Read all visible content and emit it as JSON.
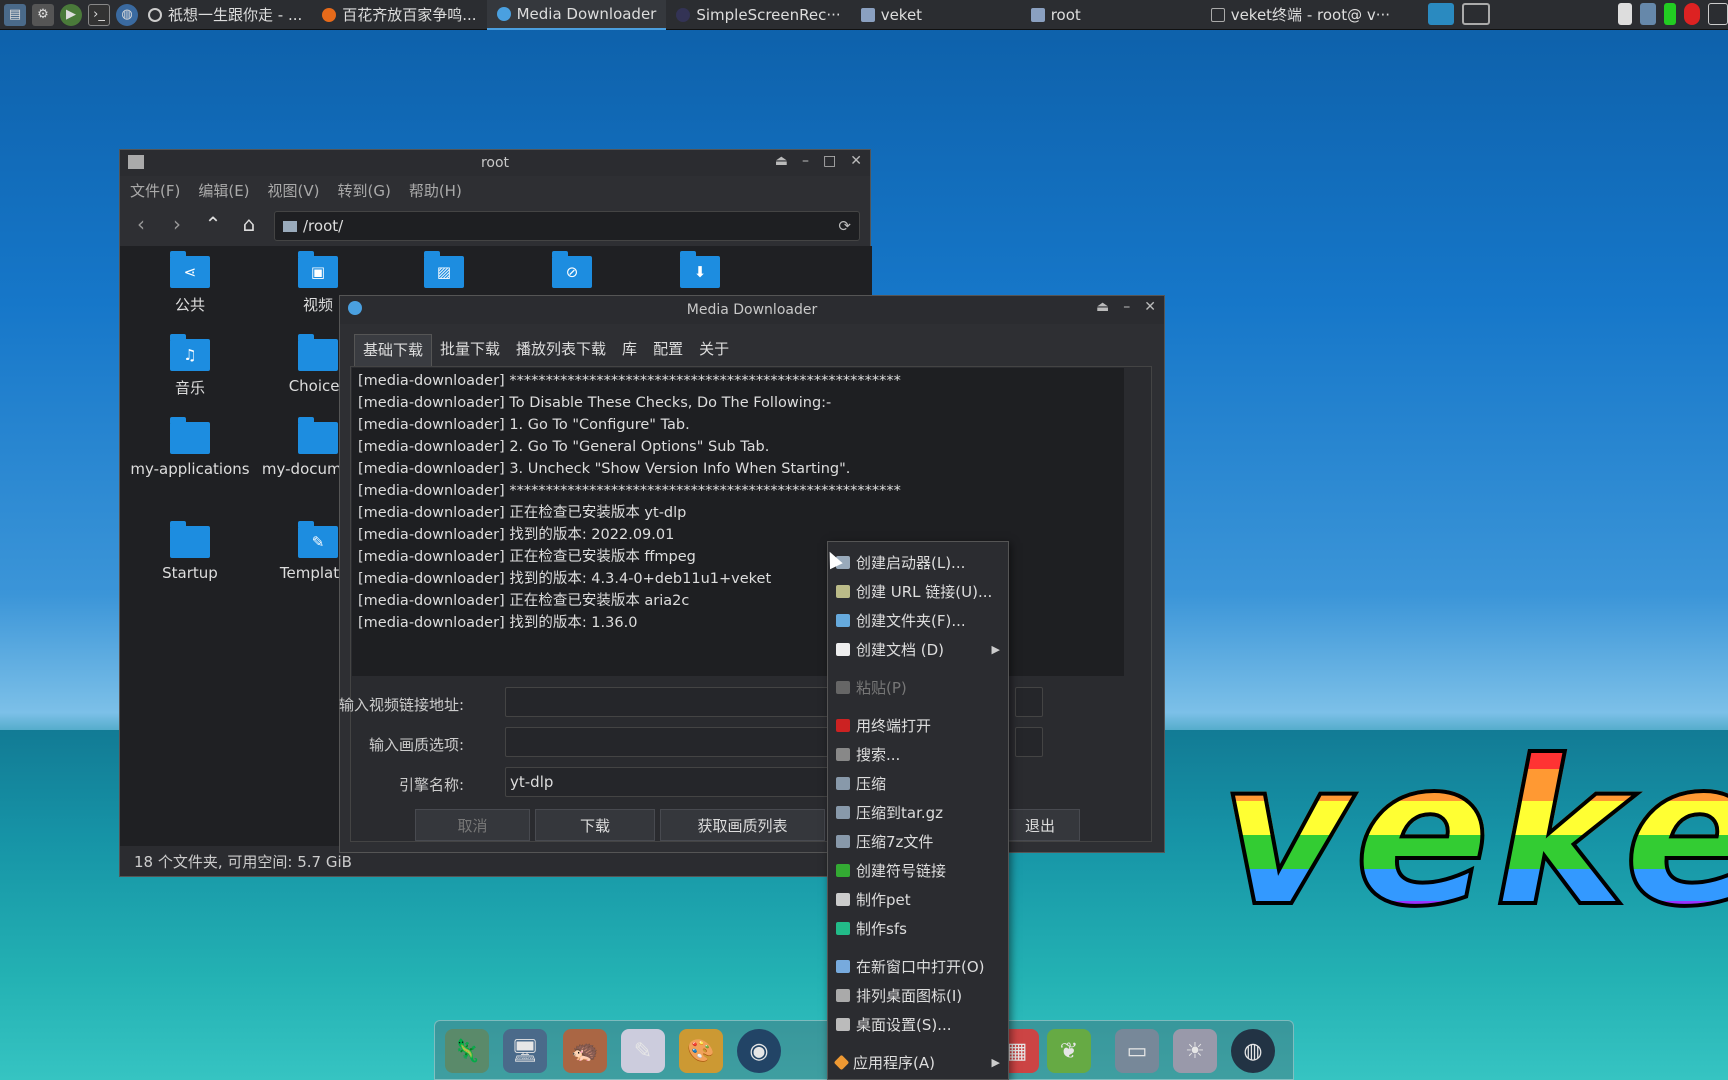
{
  "taskbar": {
    "tasks": [
      {
        "label": "祇想一生跟你走 - ...",
        "active": false
      },
      {
        "label": "百花齐放百家争鸣...",
        "active": false
      },
      {
        "label": "Media Downloader",
        "active": true
      },
      {
        "label": "SimpleScreenRec···",
        "active": false
      },
      {
        "label": "veket",
        "active": false
      },
      {
        "label": "root",
        "active": false
      },
      {
        "label": "veket终端 - root@ v···",
        "active": false
      }
    ]
  },
  "desktop": {
    "logo": "veket"
  },
  "file_manager": {
    "title": "root",
    "menu": [
      "文件(F)",
      "编辑(E)",
      "视图(V)",
      "转到(G)",
      "帮助(H)"
    ],
    "path": "/root/",
    "items": [
      {
        "label": "公共",
        "icon": "share-icon"
      },
      {
        "label": "视频",
        "icon": "video-icon"
      },
      {
        "label": "",
        "icon": "picture-icon"
      },
      {
        "label": "",
        "icon": "link-icon"
      },
      {
        "label": "",
        "icon": "download-icon"
      },
      {
        "label": "音乐",
        "icon": "music-icon"
      },
      {
        "label": "Choices",
        "icon": "folder-icon"
      },
      {
        "label": "my-applications",
        "icon": "folder-icon"
      },
      {
        "label": "my-documents",
        "icon": "folder-icon"
      },
      {
        "label": "Startup",
        "icon": "folder-icon"
      },
      {
        "label": "Templates",
        "icon": "template-icon"
      }
    ],
    "status": "18 个文件夹, 可用空间: 5.7 GiB"
  },
  "media_downloader": {
    "title": "Media Downloader",
    "tabs": [
      "基础下载",
      "批量下载",
      "播放列表下载",
      "库",
      "配置",
      "关于"
    ],
    "log": [
      "[media-downloader] ******************************************************",
      "[media-downloader] To Disable These Checks, Do The Following:-",
      "[media-downloader] 1. Go To \"Configure\" Tab.",
      "[media-downloader] 2. Go To \"General Options\" Sub Tab.",
      "[media-downloader] 3. Uncheck \"Show Version Info When Starting\".",
      "[media-downloader] ******************************************************",
      "[media-downloader] 正在检查已安装版本 yt-dlp",
      "[media-downloader] 找到的版本: 2022.09.01",
      "[media-downloader] 正在检查已安装版本 ffmpeg",
      "[media-downloader] 找到的版本: 4.3.4-0+deb11u1+veket",
      "[media-downloader] 正在检查已安装版本 aria2c",
      "[media-downloader] 找到的版本: 1.36.0"
    ],
    "url_label": "输入视频链接地址:",
    "url_value": "",
    "quality_label": "输入画质选项:",
    "quality_value": "",
    "engine_label": "引擎名称:",
    "engine_value": "yt-dlp",
    "buttons": {
      "cancel": "取消",
      "download": "下载",
      "list_formats": "获取画质列表",
      "quit": "退出"
    }
  },
  "context_menu": {
    "items": [
      {
        "label": "创建启动器(L)...",
        "icon": "launcher-icon",
        "disabled": false,
        "submenu": false
      },
      {
        "label": "创建 URL 链接(U)...",
        "icon": "url-link-icon",
        "disabled": false,
        "submenu": false
      },
      {
        "label": "创建文件夹(F)...",
        "icon": "folder-icon",
        "disabled": false,
        "submenu": false
      },
      {
        "label": "创建文档 (D)",
        "icon": "document-icon",
        "disabled": false,
        "submenu": true
      },
      {
        "separator": true
      },
      {
        "label": "粘贴(P)",
        "icon": "paste-icon",
        "disabled": true,
        "submenu": false
      },
      {
        "separator": true
      },
      {
        "label": "用终端打开",
        "icon": "terminal-icon",
        "disabled": false,
        "submenu": false
      },
      {
        "label": "搜索...",
        "icon": "search-icon",
        "disabled": false,
        "submenu": false
      },
      {
        "label": "压缩",
        "icon": "archive-icon",
        "disabled": false,
        "submenu": false
      },
      {
        "label": "压缩到tar.gz",
        "icon": "archive-icon",
        "disabled": false,
        "submenu": false
      },
      {
        "label": "压缩7z文件",
        "icon": "archive-icon",
        "disabled": false,
        "submenu": false
      },
      {
        "label": "创建符号链接",
        "icon": "symlink-icon",
        "disabled": false,
        "submenu": false
      },
      {
        "label": "制作pet",
        "icon": "package-icon",
        "disabled": false,
        "submenu": false
      },
      {
        "label": "制作sfs",
        "icon": "sfs-icon",
        "disabled": false,
        "submenu": false
      },
      {
        "separator": true
      },
      {
        "label": "在新窗口中打开(O)",
        "icon": "new-window-icon",
        "disabled": false,
        "submenu": false
      },
      {
        "label": "排列桌面图标(I)",
        "icon": "sort-icon",
        "disabled": false,
        "submenu": false
      },
      {
        "label": "桌面设置(S)...",
        "icon": "settings-icon",
        "disabled": false,
        "submenu": false
      },
      {
        "separator": true
      },
      {
        "label": "应用程序(A)",
        "icon": "apps-icon",
        "disabled": false,
        "submenu": true
      }
    ]
  }
}
